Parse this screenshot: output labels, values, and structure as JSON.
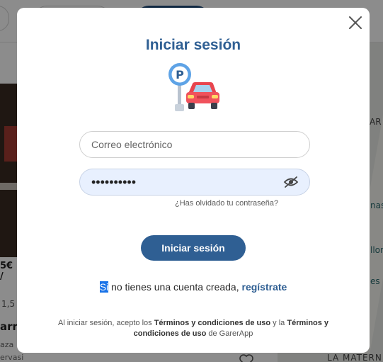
{
  "background": {
    "price": "5€ /",
    "rating": "1,5",
    "title": "arra",
    "sub1": "aza",
    "sub2": "ervasi",
    "map_labels": [
      "nas",
      "llon",
      "es",
      "LA MATERN",
      "AR"
    ]
  },
  "modal": {
    "title": "Iniciar sesión",
    "email_placeholder": "Correo electrónico",
    "password_value": "••••••••••",
    "forgot_text": "¿Has olvidado tu contraseña?",
    "login_button": "Iniciar sesión",
    "register_prefix_highlight": "Si",
    "register_prefix": " no tienes una cuenta creada, ",
    "register_link": "regístrate",
    "terms": {
      "t1": "Al iniciar sesión, acepto los ",
      "link1": "Términos y condiciones de uso",
      "t2": " y la ",
      "link2": "Términos y condiciones de uso",
      "t3": " de GarerApp"
    }
  },
  "icons": {
    "close": "close-icon",
    "eye": "eye-off-icon",
    "illustration": "parking-car-illustration"
  },
  "colors": {
    "primary": "#2f5f93",
    "autofill": "#e8f0fe"
  }
}
